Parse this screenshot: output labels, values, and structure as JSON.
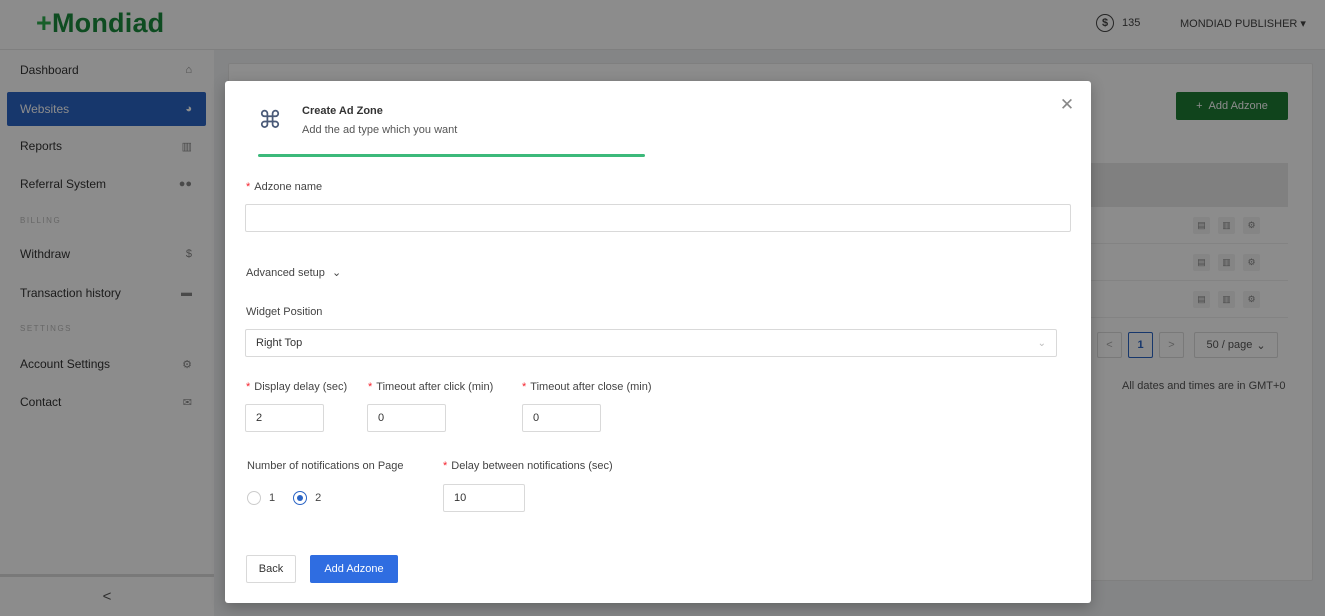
{
  "header": {
    "logo": "Mondiad",
    "balance": "135",
    "user": "MONDIAD PUBLISHER"
  },
  "sidebar": {
    "items": [
      {
        "label": "Dashboard",
        "icon": "home-icon"
      },
      {
        "label": "Websites",
        "icon": "pie-chart-icon",
        "active": true
      },
      {
        "label": "Reports",
        "icon": "bar-chart-icon"
      },
      {
        "label": "Referral System",
        "icon": "users-icon"
      }
    ],
    "billing_title": "BILLING",
    "billing_items": [
      {
        "label": "Withdraw",
        "icon": "dollar-icon"
      },
      {
        "label": "Transaction history",
        "icon": "wallet-icon"
      }
    ],
    "settings_title": "SETTINGS",
    "settings_items": [
      {
        "label": "Account Settings",
        "icon": "gears-icon"
      },
      {
        "label": "Contact",
        "icon": "envelope-icon"
      }
    ],
    "collapse": "<"
  },
  "background": {
    "add_button": "Add Adzone",
    "current_page": "1",
    "page_size": "50 / page",
    "note": "All dates and times are in GMT+0"
  },
  "modal": {
    "title": "Create Ad Zone",
    "subtitle": "Add the ad type which you want",
    "adzone_name_label": "Adzone name",
    "adzone_name_value": "",
    "advanced_label": "Advanced setup",
    "widget_position_label": "Widget Position",
    "widget_position_value": "Right Top",
    "display_delay_label": "Display delay (sec)",
    "display_delay_value": "2",
    "timeout_click_label": "Timeout after click (min)",
    "timeout_click_value": "0",
    "timeout_close_label": "Timeout after close (min)",
    "timeout_close_value": "0",
    "notifications_label": "Number of notifications on Page",
    "notifications_options": [
      "1",
      "2"
    ],
    "notifications_selected": "2",
    "delay_between_label": "Delay between notifications (sec)",
    "delay_between_value": "10",
    "back_button": "Back",
    "submit_button": "Add Adzone"
  },
  "colors": {
    "primary": "#2f6de1",
    "sidebar_active": "#2a64c5",
    "progress": "#3cb97a",
    "brand_green": "#1a8a3c",
    "required": "#f5222d"
  }
}
